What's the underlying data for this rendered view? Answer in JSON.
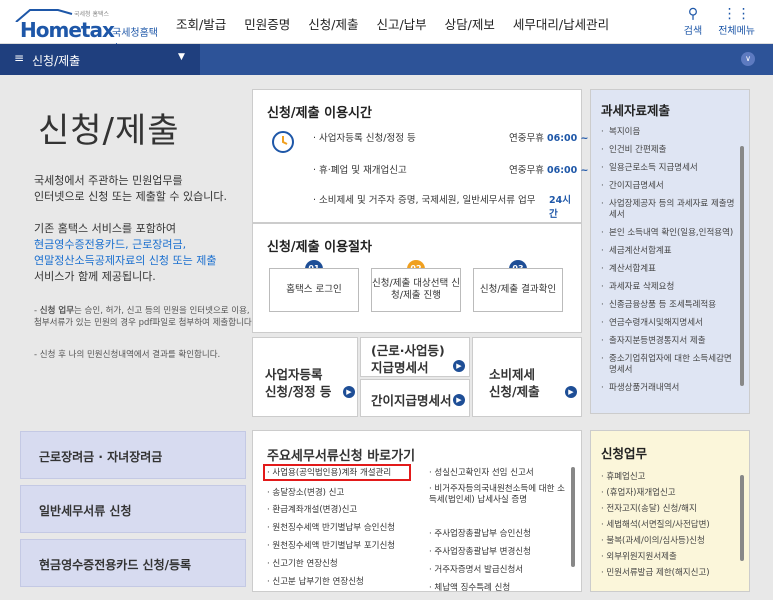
{
  "header": {
    "logo_small": "국세청 홈택스",
    "logo_brand": "Hometax",
    "logo_name": "국세청홈택스",
    "nav": [
      "조회/발급",
      "민원증명",
      "신청/제출",
      "신고/납부",
      "상담/제보",
      "세무대리/납세관리"
    ],
    "search_label": "검색",
    "menu_label": "전체메뉴"
  },
  "subnav": {
    "current": "신청/제출"
  },
  "hero": {
    "title": "신청/제출",
    "desc1": "국세청에서 주관하는 민원업무를",
    "desc2": "인터넷으로 신청 또는 제출할 수 있습니다.",
    "desc3": "기존 홈택스 서비스를 포함하여",
    "desc4": "현금영수증전용카드, 근로장려금,",
    "desc5": "연말정산소득공제자료의 신청 또는 제출",
    "desc6": "서비스가 함께 제공됩니다.",
    "note1_bold": "신청 업무",
    "note1": "는 승인, 허가, 신고 등의 민원을 인터넷으로 이용, 첨부서류가 있는 민원의 경우 pdf파일로 첨부하여 제출합니다.",
    "note2": "신청 후 나의 민원신청내역에서 결과를 확인합니다."
  },
  "time": {
    "title": "신청/제출 이용시간",
    "rows": [
      {
        "label": "사업자등록 신청/정정 등",
        "time_prefix": "연중무휴",
        "time": "06:00 ~ 24:00"
      },
      {
        "label": "휴·폐업 및 재개업신고",
        "time_prefix": "연중무휴",
        "time": "06:00 ~ 24:00"
      },
      {
        "label": "소비제세 및 거주자 증명, 국제세원, 일반세무서류 업무",
        "time_prefix": "",
        "time": "24시간"
      }
    ]
  },
  "proc": {
    "title": "신청/제출 이용절차",
    "steps": [
      {
        "n": "01",
        "label": "홈택스 로그인"
      },
      {
        "n": "02",
        "label": "신청/제출 대상선택 신청/제출 진행"
      },
      {
        "n": "03",
        "label": "신청/제출 결과확인"
      }
    ]
  },
  "big": {
    "b1a": "사업자등록",
    "b1b": "신청/정정 등",
    "b2a": "(근로·사업등)",
    "b2b": "지급명세서",
    "b3": "간이지급명세서",
    "b4a": "소비제세",
    "b4b": "신청/제출"
  },
  "tax_data": {
    "title": "과세자료제출",
    "items": [
      "복지이음",
      "인건비 간편제출",
      "일용근로소득 지급명세서",
      "간이지급명세서",
      "사업장제공자 등의 과세자료 제출명세서",
      "본인 소득내역 확인(일용,인적용역)",
      "세금계산서합계표",
      "계산서합계표",
      "과세자료 삭제요청",
      "신종금융상품 등 조세특례적용",
      "연금수령개시및해지명세서",
      "출자지분등변경통지서 제출",
      "중소기업취업자에 대한 소득세감면명세서",
      "파생상품거래내역서"
    ]
  },
  "left_btns": [
    "근로장려금 · 자녀장려금",
    "일반세무서류 신청",
    "현금영수증전용카드 신청/등록"
  ],
  "quick": {
    "title": "주요세무서류신청 바로가기",
    "col1": [
      "사업용(공익법인용)계좌 개설관리",
      "송달장소(변경) 신고",
      "환급계좌개설(변경)신고",
      "원천징수세액 반기별납부 승인신청",
      "원천징수세액 반기별납부 포기신청",
      "신고기한 연장신청",
      "신고분 납부기한 연장신청"
    ],
    "col2": [
      "성실신고확인자 선임 신고서",
      "비거주자등의국내원천소득에 대한 소득세(법인세) 납세사실 증명",
      "주사업장총괄납부 승인신청",
      "주사업장총괄납부 변경신청",
      "거주자증명서 발급신청서",
      "체납액 징수특례 신청"
    ]
  },
  "apply": {
    "title": "신청업무",
    "items": [
      "휴폐업신고",
      "(휴업자)재개업신고",
      "전자고지(송달) 신청/해지",
      "세법해석(서면질의/사전답변)",
      "불복(과세/이의/심사등)신청",
      "외부위원지원서제출",
      "민원서류발급 제한(해지신고)"
    ]
  },
  "colors": {
    "brand": "#1e57a8",
    "nav_bar": "#2d5398",
    "highlight": "#e21a1a"
  }
}
